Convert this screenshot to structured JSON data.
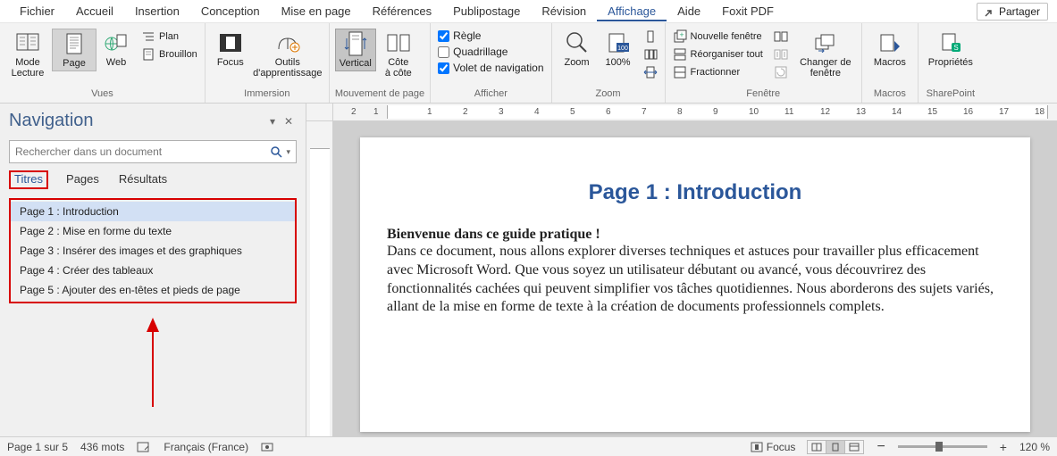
{
  "menu": {
    "items": [
      "Fichier",
      "Accueil",
      "Insertion",
      "Conception",
      "Mise en page",
      "Références",
      "Publipostage",
      "Révision",
      "Affichage",
      "Aide",
      "Foxit PDF"
    ],
    "active_index": 8,
    "share": "Partager"
  },
  "ribbon": {
    "groups": {
      "vues": {
        "label": "Vues",
        "mode_lecture": "Mode\nLecture",
        "page": "Page",
        "web": "Web",
        "plan": "Plan",
        "brouillon": "Brouillon"
      },
      "immersion": {
        "label": "Immersion",
        "focus": "Focus",
        "outils": "Outils\nd'apprentissage"
      },
      "mouvement": {
        "label": "Mouvement de page",
        "vertical": "Vertical",
        "cote": "Côte\nà côte"
      },
      "afficher": {
        "label": "Afficher",
        "regle": "Règle",
        "quadrillage": "Quadrillage",
        "volet": "Volet de navigation"
      },
      "zoom": {
        "label": "Zoom",
        "zoom": "Zoom",
        "cent": "100%"
      },
      "fenetre": {
        "label": "Fenêtre",
        "nouvelle": "Nouvelle fenêtre",
        "reorg": "Réorganiser tout",
        "frac": "Fractionner",
        "changer": "Changer de\nfenêtre"
      },
      "macros": {
        "label": "Macros",
        "macros": "Macros"
      },
      "sharepoint": {
        "label": "SharePoint",
        "prop": "Propriétés"
      }
    }
  },
  "nav": {
    "title": "Navigation",
    "search_placeholder": "Rechercher dans un document",
    "tabs": [
      "Titres",
      "Pages",
      "Résultats"
    ],
    "active_tab": 0,
    "items": [
      "Page 1 : Introduction",
      "Page 2 : Mise en forme du texte",
      "Page 3 : Insérer des images et des graphiques",
      "Page 4 : Créer des tableaux",
      "Page 5 : Ajouter des en-têtes et pieds de page"
    ],
    "selected_index": 0
  },
  "ruler": {
    "ticks": [
      "2",
      "1",
      "",
      "1",
      "2",
      "3",
      "4",
      "5",
      "6",
      "7",
      "8",
      "9",
      "10",
      "11",
      "12",
      "13",
      "14",
      "15",
      "16",
      "17",
      "18"
    ]
  },
  "doc": {
    "heading": "Page 1 : Introduction",
    "lead": "Bienvenue dans ce guide pratique !",
    "body": "Dans ce document, nous allons explorer diverses techniques et astuces pour travailler plus efficacement avec Microsoft Word. Que vous soyez un utilisateur débutant ou avancé, vous découvrirez des fonctionnalités cachées qui peuvent simplifier vos tâches quotidiennes. Nous aborderons des sujets variés, allant de la mise en forme de texte à la création de documents professionnels complets."
  },
  "status": {
    "page": "Page 1 sur 5",
    "words": "436 mots",
    "lang": "Français (France)",
    "focus": "Focus",
    "zoom": "120 %"
  }
}
